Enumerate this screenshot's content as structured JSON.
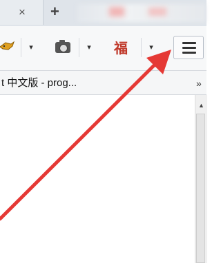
{
  "tabbar": {
    "close_glyph": "×",
    "newtab_glyph": "+"
  },
  "toolbar": {
    "dropdown_glyph": "▾",
    "fu_glyph": "福",
    "icons": [
      "bird-icon",
      "camera-icon",
      "fu-icon",
      "menu-icon"
    ]
  },
  "bookmarks": {
    "item_label": "t 中文版 - prog...",
    "more_glyph": "»"
  },
  "scrollbar": {
    "up_glyph": "▲"
  },
  "annotation": {
    "arrow_color": "#e53935"
  }
}
